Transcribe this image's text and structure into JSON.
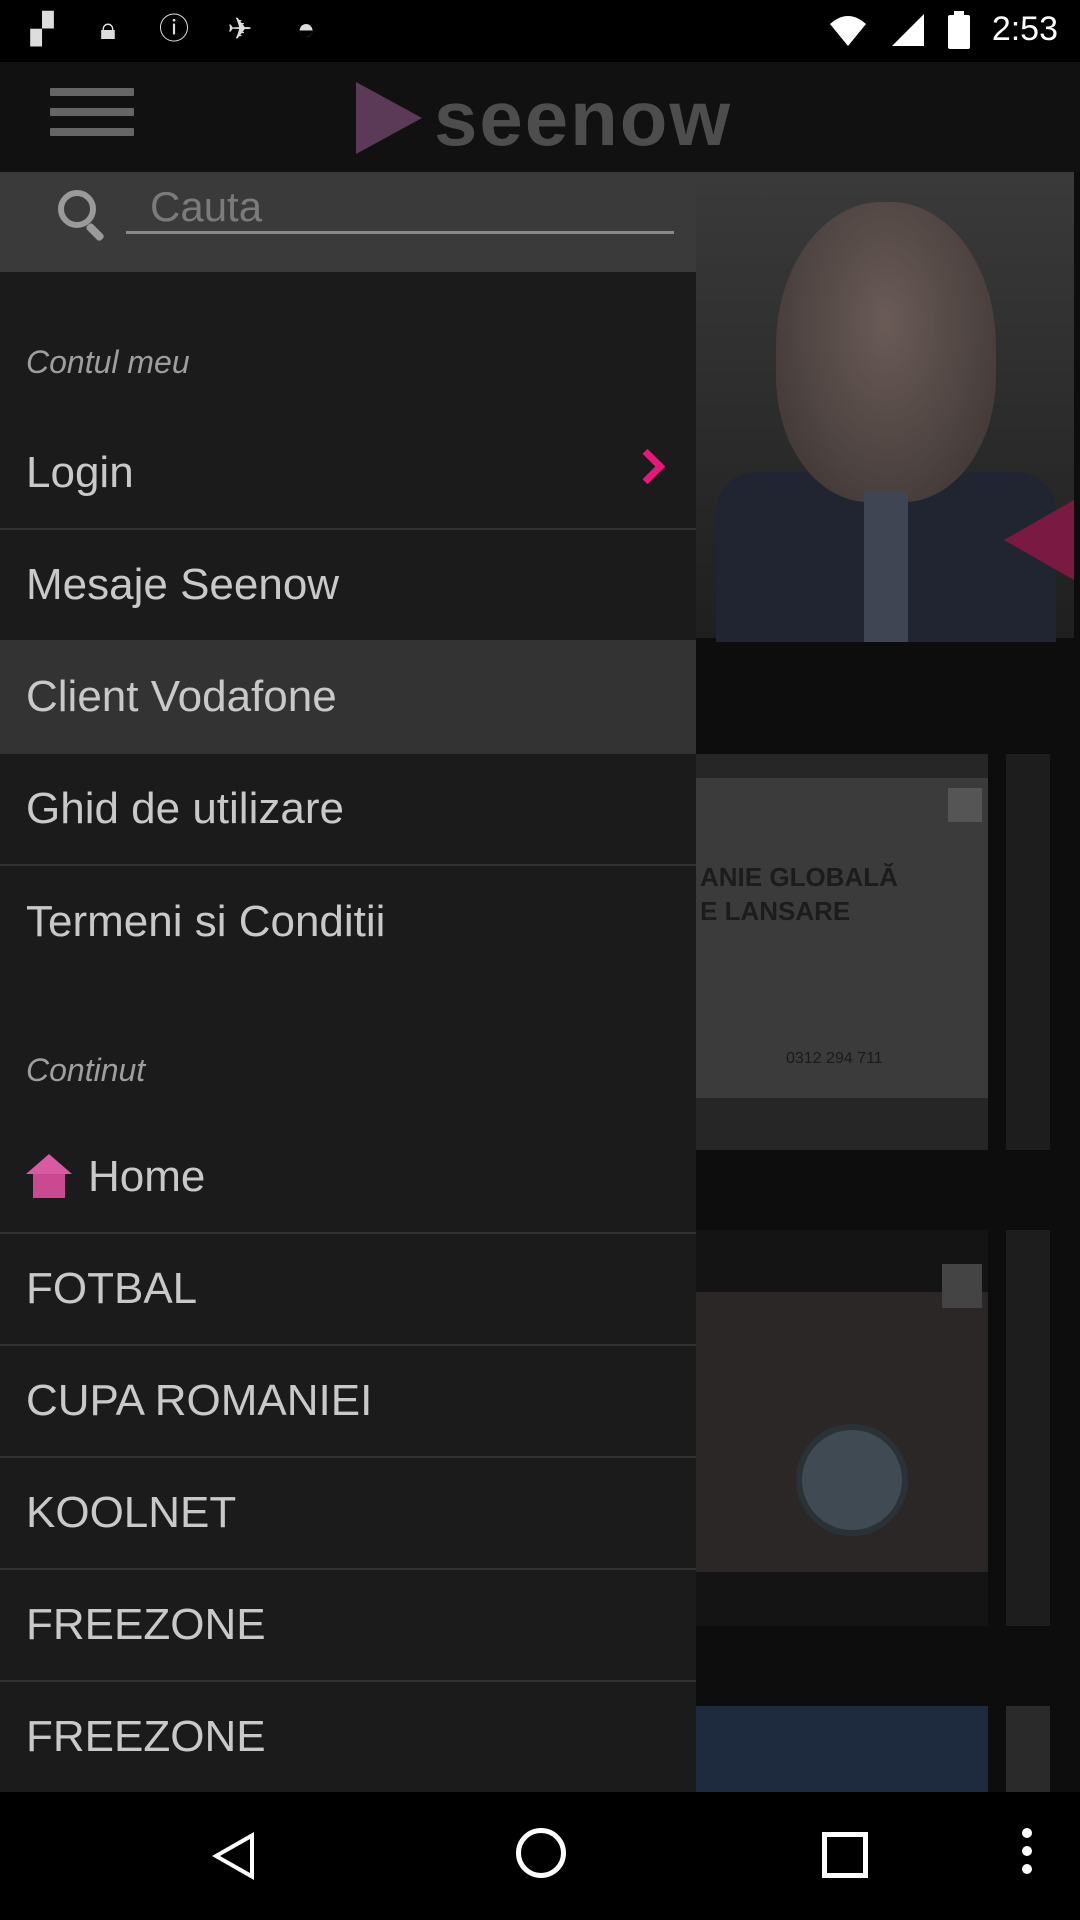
{
  "status_bar": {
    "time": "2:53",
    "left_icons": [
      "flipboard-icon",
      "lock-icon",
      "alert-icon",
      "fake-gps-icon",
      "android-icon"
    ],
    "right_icons": [
      "wifi-icon",
      "signal-icon",
      "battery-icon"
    ]
  },
  "header": {
    "menu_icon": "hamburger-icon",
    "logo_text": "seenow"
  },
  "drawer": {
    "search": {
      "placeholder": "Cauta",
      "value": ""
    },
    "account_section": {
      "label": "Contul meu",
      "items": [
        {
          "label": "Login",
          "chevron": true
        },
        {
          "label": "Mesaje Seenow"
        },
        {
          "label": "Client Vodafone",
          "selected": true
        },
        {
          "label": "Ghid de utilizare"
        },
        {
          "label": "Termeni si Conditii"
        }
      ]
    },
    "content_section": {
      "label": "Continut",
      "items": [
        {
          "label": "Home",
          "icon": "home-icon"
        },
        {
          "label": "FOTBAL"
        },
        {
          "label": "CUPA ROMANIEI"
        },
        {
          "label": "KOOLNET"
        },
        {
          "label": "FREEZONE"
        },
        {
          "label": "FREEZONE"
        }
      ]
    }
  },
  "background_tiles": {
    "tile1_text_line1": "ANIE GLOBALĂ",
    "tile1_text_line2": "E LANSARE",
    "tile1_phone": "0312 294 711"
  },
  "colors": {
    "accent": "#e6197a",
    "drawer_bg": "#1b1b1b",
    "selected_bg": "#333333"
  },
  "nav_bar": {
    "buttons": [
      "back-icon",
      "home-icon",
      "recents-icon",
      "more-icon"
    ]
  }
}
